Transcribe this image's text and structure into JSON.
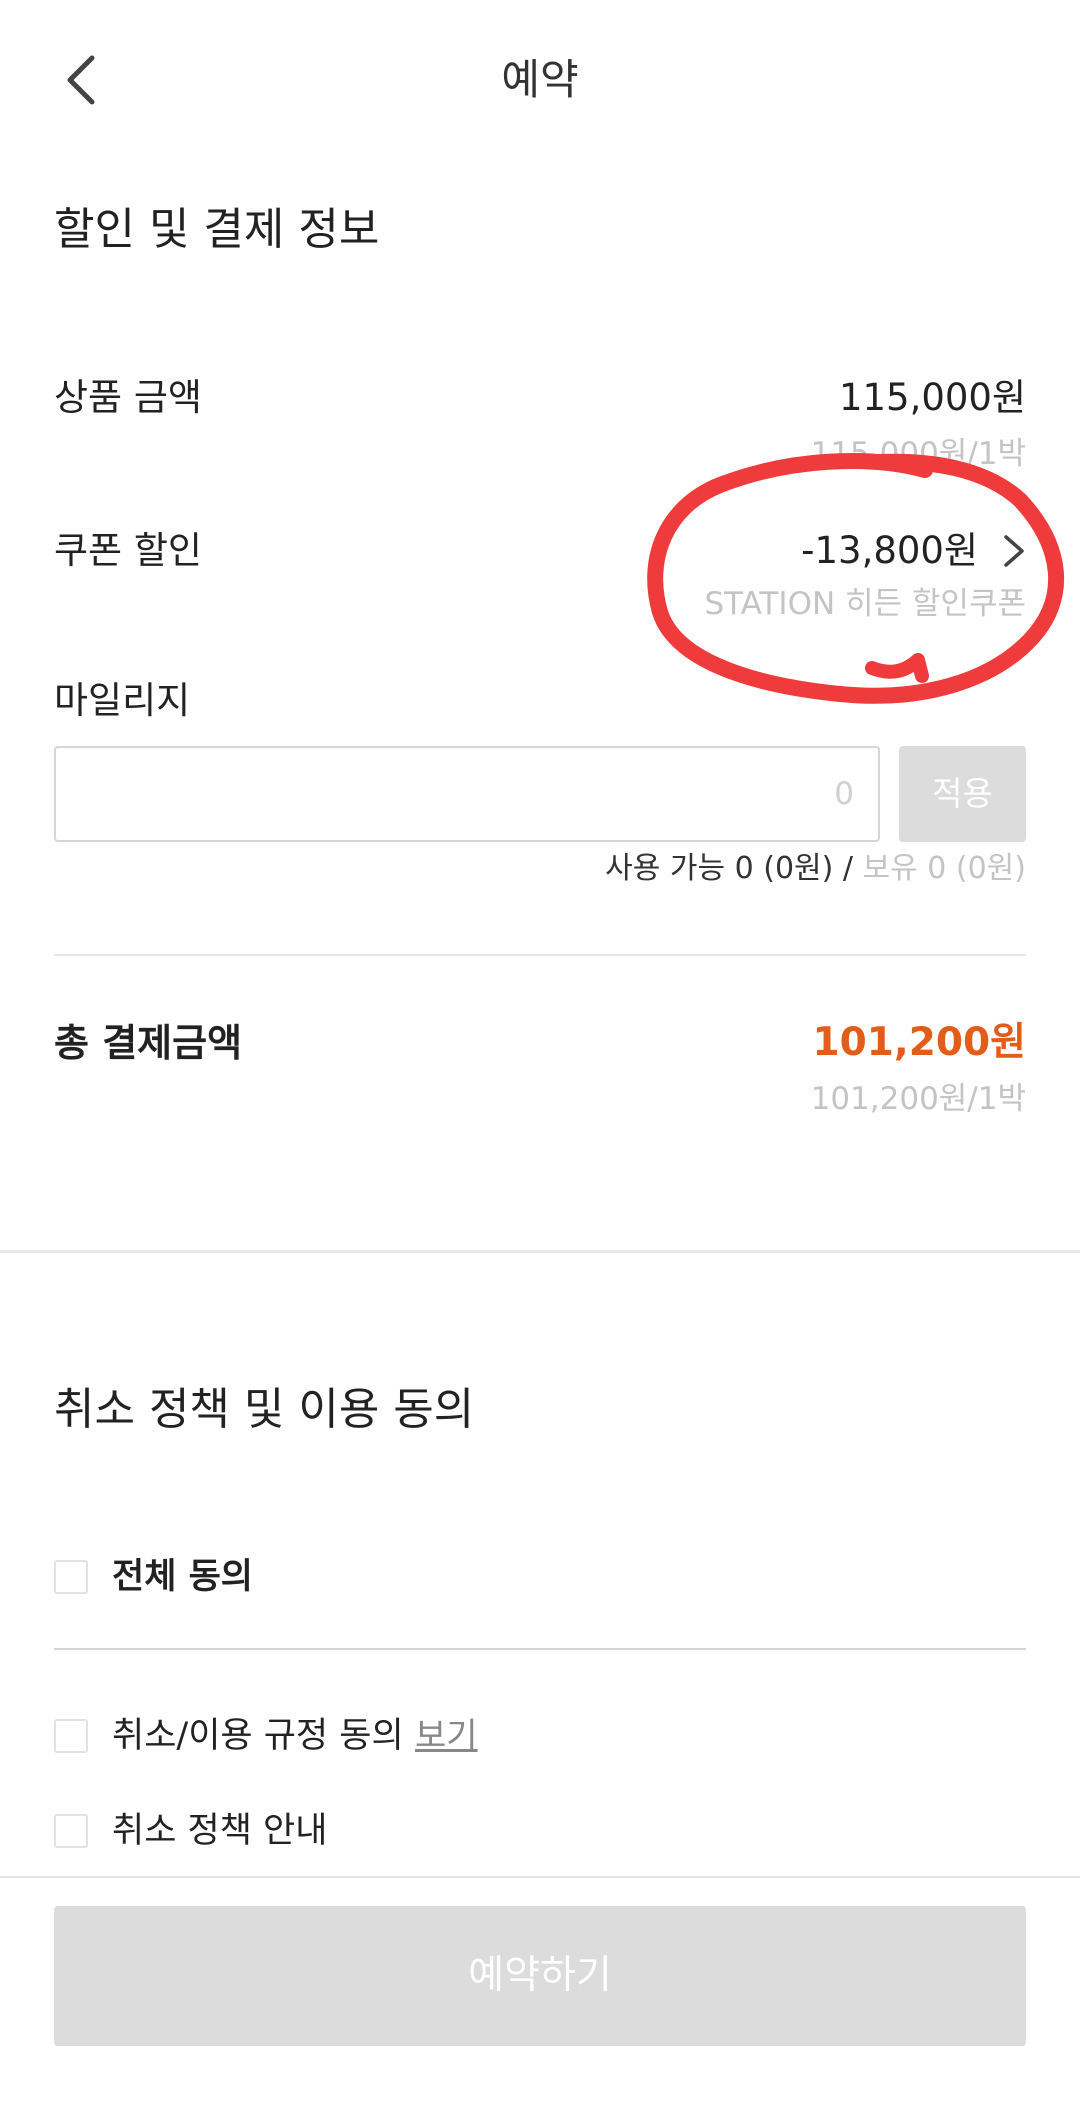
{
  "header": {
    "back_icon": "chevron-left-icon",
    "title": "예약"
  },
  "payment": {
    "section_title": "할인 및 결제 정보",
    "product_price": {
      "label": "상품 금액",
      "value": "115,000원",
      "sub": "115,000원/1박"
    },
    "coupon": {
      "label": "쿠폰 할인",
      "value": "-13,800원",
      "sub": "STATION 히든 할인쿠폰",
      "icon": "chevron-right-icon"
    },
    "mileage": {
      "label": "마일리지",
      "input_value": "",
      "input_placeholder": "0",
      "apply_label": "적용",
      "available": "사용 가능 0 (0원)",
      "separator": " / ",
      "owned": "보유 0 (0원)"
    },
    "total": {
      "label": "총 결제금액",
      "value": "101,200원",
      "sub": "101,200원/1박"
    }
  },
  "agreement": {
    "section_title": "취소 정책 및 이용 동의",
    "all_agree": "전체 동의",
    "items": [
      {
        "label": "취소/이용 규정 동의",
        "link": "보기"
      },
      {
        "label": "취소 정책 안내"
      }
    ]
  },
  "footer": {
    "reserve_label": "예약하기"
  },
  "colors": {
    "accent": "#e25c1a",
    "annotation": "#ef3b3b",
    "disabled": "#dcdcdc",
    "muted": "#c4c4c4"
  }
}
